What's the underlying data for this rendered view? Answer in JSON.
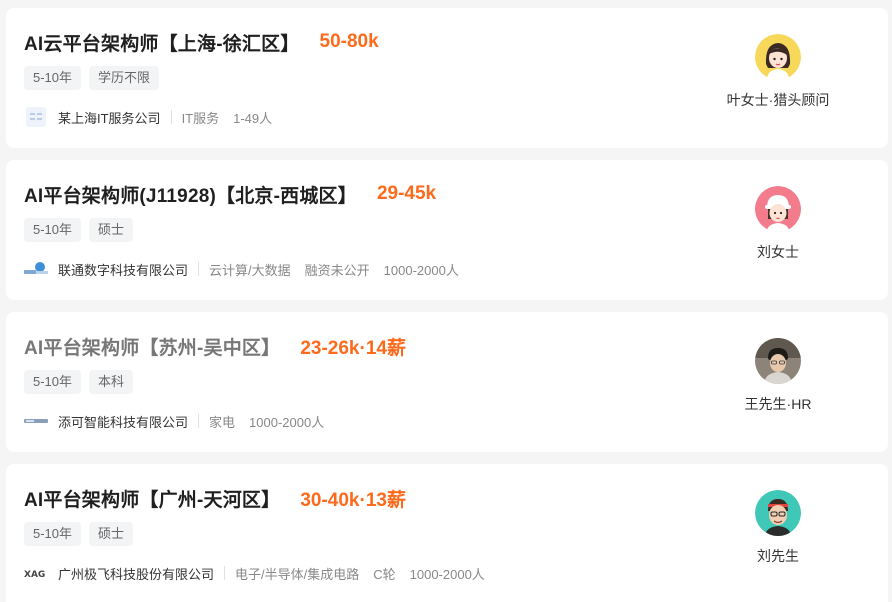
{
  "jobs": [
    {
      "title": "AI云平台架构师【上海-徐汇区】",
      "salary": "50-80k",
      "tags": [
        "5-10年",
        "学历不限"
      ],
      "company": "某上海IT服务公司",
      "meta": [
        "IT服务",
        "1-49人"
      ],
      "logo_icon": "placeholder-logo-icon",
      "recruiter": "叶女士·猎头顾问",
      "avatar_icon": "woman-avatar-icon"
    },
    {
      "title": "AI平台架构师(J11928)【北京-西城区】",
      "salary": "29-45k",
      "tags": [
        "5-10年",
        "硕士"
      ],
      "company": "联通数字科技有限公司",
      "meta": [
        "云计算/大数据",
        "融资未公开",
        "1000-2000人"
      ],
      "logo_icon": "unicom-logo-icon",
      "recruiter": "刘女士",
      "avatar_icon": "woman-cap-avatar-icon"
    },
    {
      "title": "AI平台架构师【苏州-吴中区】",
      "salary": "23-26k·14薪",
      "tags": [
        "5-10年",
        "本科"
      ],
      "company": "添可智能科技有限公司",
      "meta": [
        "家电",
        "1000-2000人"
      ],
      "logo_icon": "tineco-logo-icon",
      "recruiter": "王先生·HR",
      "avatar_icon": "photo-avatar-icon"
    },
    {
      "title": "AI平台架构师【广州-天河区】",
      "salary": "30-40k·13薪",
      "tags": [
        "5-10年",
        "硕士"
      ],
      "company": "广州极飞科技股份有限公司",
      "meta": [
        "电子/半导体/集成电路",
        "C轮",
        "1000-2000人"
      ],
      "logo_icon": "xag-logo-icon",
      "logo_text": "XAG",
      "recruiter": "刘先生",
      "avatar_icon": "man-avatar-icon"
    }
  ],
  "colors": {
    "salary": "#fe6a1c",
    "title": "#1f1f1f",
    "visited_title": "#777777",
    "tag_bg": "#f3f4f6"
  }
}
